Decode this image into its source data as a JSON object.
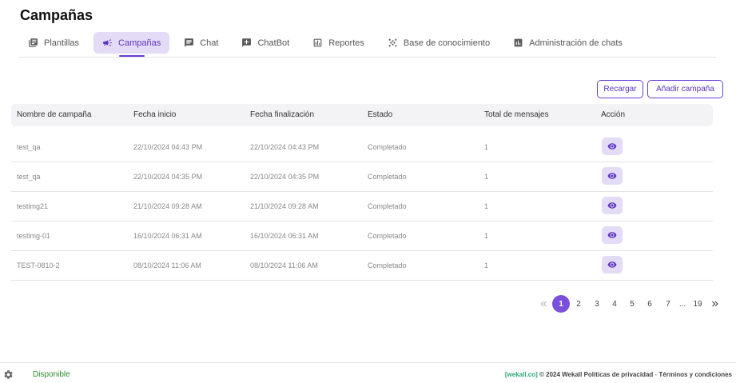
{
  "page": {
    "title": "Campañas"
  },
  "tabs": [
    {
      "label": "Plantillas",
      "icon": "library-icon"
    },
    {
      "label": "Campañas",
      "icon": "megaphone-icon",
      "active": true
    },
    {
      "label": "Chat",
      "icon": "chat-icon"
    },
    {
      "label": "ChatBot",
      "icon": "chatbot-icon"
    },
    {
      "label": "Reportes",
      "icon": "chart-icon"
    },
    {
      "label": "Base de conocimiento",
      "icon": "dots-pattern-icon"
    },
    {
      "label": "Administración de chats",
      "icon": "admin-chart-icon"
    }
  ],
  "actions": {
    "reload": "Recargar",
    "add_campaign": "Añadir campaña"
  },
  "table": {
    "columns": [
      "Nombre de campaña",
      "Fecha inicio",
      "Fecha finalización",
      "Estado",
      "Total de mensajes",
      "Acción"
    ],
    "rows": [
      {
        "name": "test_qa",
        "start": "22/10/2024 04:43 PM",
        "end": "22/10/2024 04:43 PM",
        "status": "Completado",
        "total": "1"
      },
      {
        "name": "test_qa",
        "start": "22/10/2024 04:35 PM",
        "end": "22/10/2024 04:35 PM",
        "status": "Completado",
        "total": "1"
      },
      {
        "name": "testimg21",
        "start": "21/10/2024 09:28 AM",
        "end": "21/10/2024 09:28 AM",
        "status": "Completado",
        "total": "1"
      },
      {
        "name": "testimg-01",
        "start": "16/10/2024 06:31 AM",
        "end": "16/10/2024 06:31 AM",
        "status": "Completado",
        "total": "1"
      },
      {
        "name": "TEST-0810-2",
        "start": "08/10/2024 11:06 AM",
        "end": "08/10/2024 11:06 AM",
        "status": "Completado",
        "total": "1"
      }
    ]
  },
  "pagination": {
    "current": "1",
    "pages": [
      "1",
      "2",
      "3",
      "4",
      "5",
      "6",
      "7"
    ],
    "ellipsis": "...",
    "last": "19"
  },
  "footer": {
    "status": "Disponible",
    "brand": "[wekall.co]",
    "copyright": "© 2024 Wekall",
    "privacy": "Políticas de privacidad",
    "separator": "-",
    "terms": "Términos y condiciones"
  },
  "colors": {
    "accent": "#6a3ed6",
    "accent_bg": "#e4dcf7",
    "status_ok": "#2e8b2e",
    "brand": "#2aa87a"
  }
}
